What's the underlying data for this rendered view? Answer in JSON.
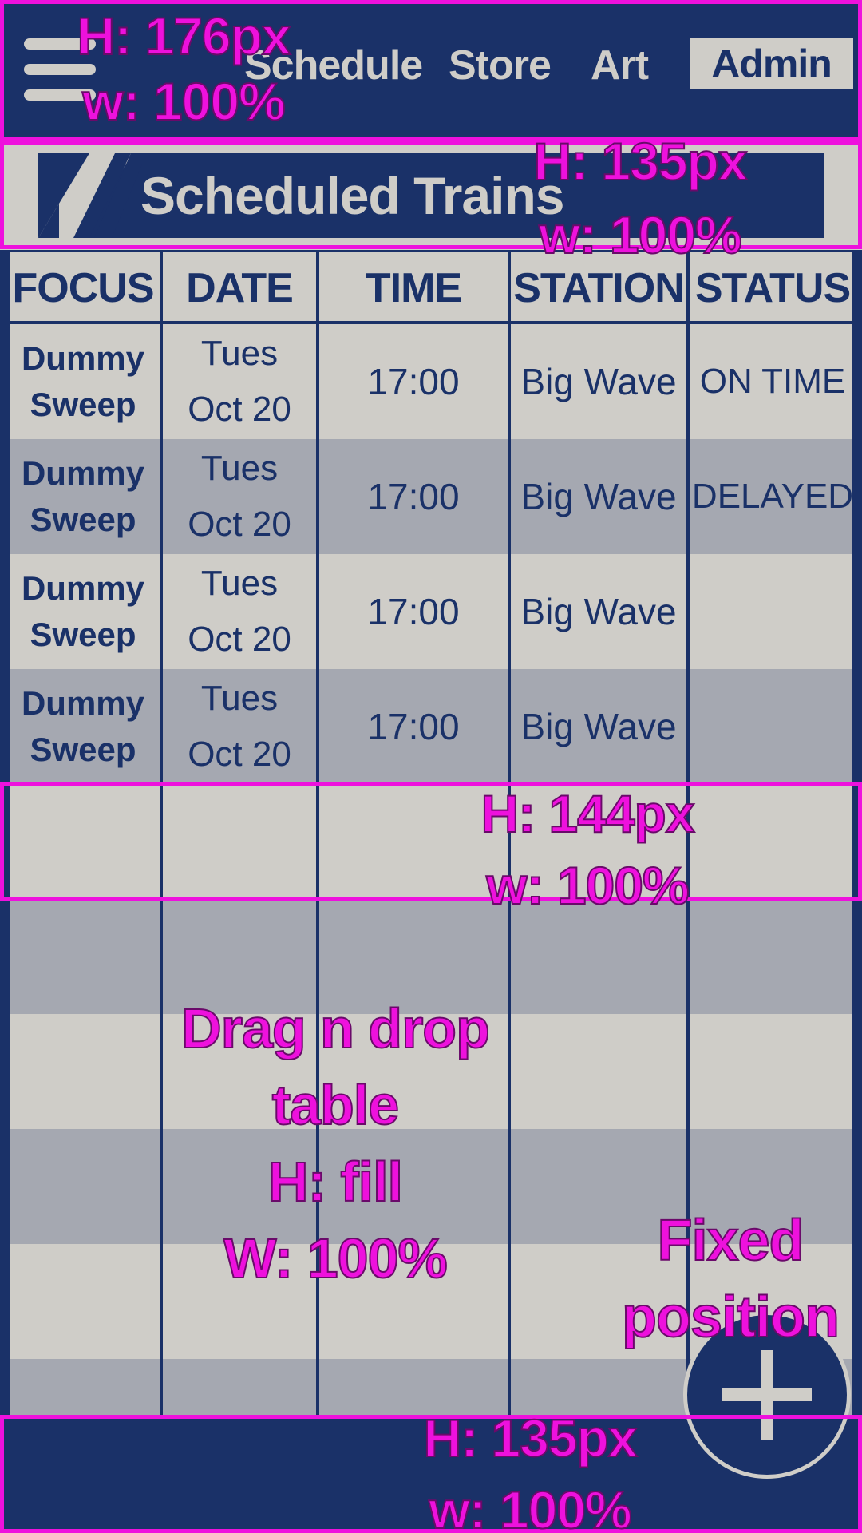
{
  "nav": {
    "links": [
      "Schedule",
      "Store",
      "Art"
    ],
    "admin": "Admin"
  },
  "banner": {
    "title": "Scheduled Trains"
  },
  "table": {
    "headers": [
      "FOCUS",
      "DATE",
      "TIME",
      "STATION",
      "STATUS"
    ],
    "rows": [
      {
        "focus1": "Dummy",
        "focus2": "Sweep",
        "date1": "Tues",
        "date2": "Oct 20",
        "time": "17:00",
        "station": "Big Wave",
        "status": "ON TIME"
      },
      {
        "focus1": "Dummy",
        "focus2": "Sweep",
        "date1": "Tues",
        "date2": "Oct 20",
        "time": "17:00",
        "station": "Big Wave",
        "status": "DELAYED"
      },
      {
        "focus1": "Dummy",
        "focus2": "Sweep",
        "date1": "Tues",
        "date2": "Oct 20",
        "time": "17:00",
        "station": "Big Wave",
        "status": ""
      },
      {
        "focus1": "Dummy",
        "focus2": "Sweep",
        "date1": "Tues",
        "date2": "Oct 20",
        "time": "17:00",
        "station": "Big Wave",
        "status": ""
      }
    ]
  },
  "annotations": {
    "header": [
      "H: 176px",
      "w: 100%"
    ],
    "banner": [
      "H: 135px",
      "w: 100%"
    ],
    "row": [
      "H: 144px",
      "w: 100%"
    ],
    "table": [
      "Drag n drop",
      "table",
      "H: fill",
      "W: 100%"
    ],
    "fab": [
      "Fixed",
      "position"
    ],
    "footer": [
      "H: 135px",
      "w: 100%"
    ]
  },
  "colors": {
    "navy": "#1a3168",
    "light": "#cfcdc8",
    "gray": "#a5a8b1",
    "annotation": "#ee11dd"
  },
  "icons": {
    "menu": "hamburger-icon",
    "add": "plus-icon"
  }
}
